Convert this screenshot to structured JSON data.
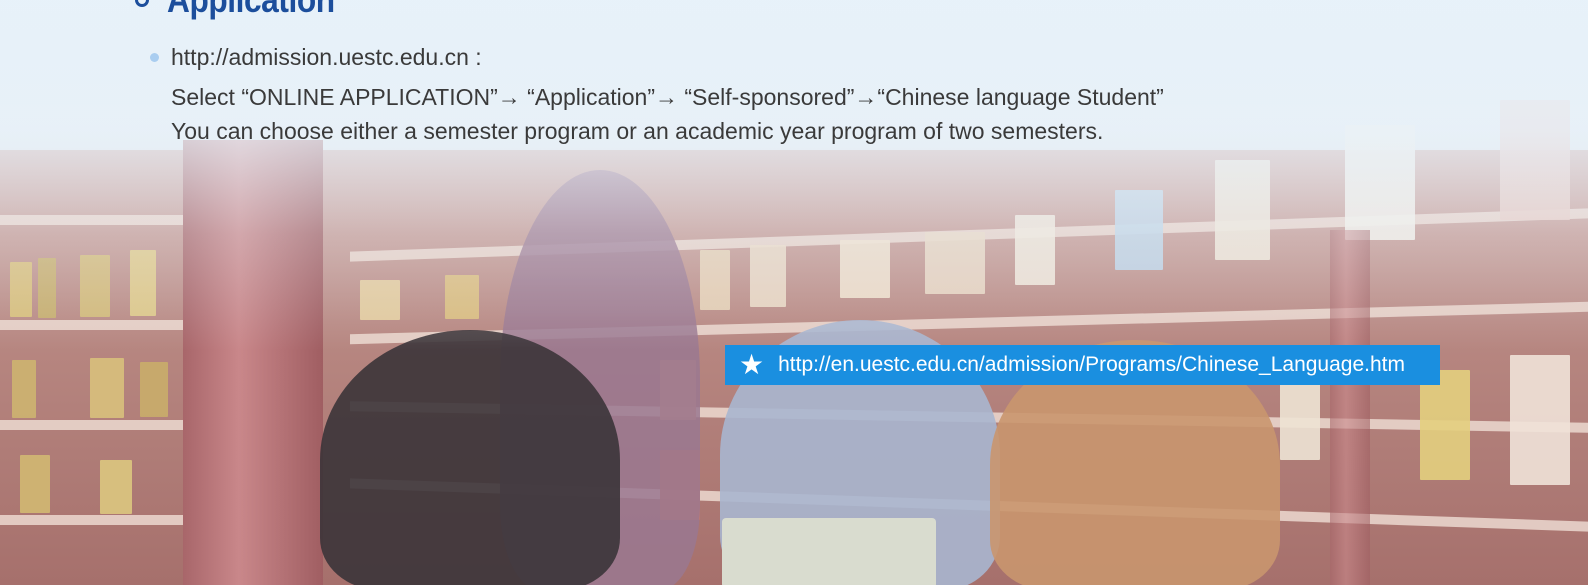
{
  "section": {
    "heading": "Application"
  },
  "content": {
    "url_line": "http://admission.uestc.edu.cn :",
    "steps_line": "Select “ONLINE APPLICATION”→ “Application”→ “Self-sponsored”→“Chinese language Student”",
    "note_line": "You can choose either a semester program or an academic year program of two semesters."
  },
  "link_bar": {
    "icon": "star-icon",
    "url": "http://en.uestc.edu.cn/admission/Programs/Chinese_Language.htm",
    "background": "#1a8fe0"
  },
  "colors": {
    "heading": "#1c4e9c",
    "bullet": "#a9cdf0",
    "body_text": "#3a3a3a"
  }
}
